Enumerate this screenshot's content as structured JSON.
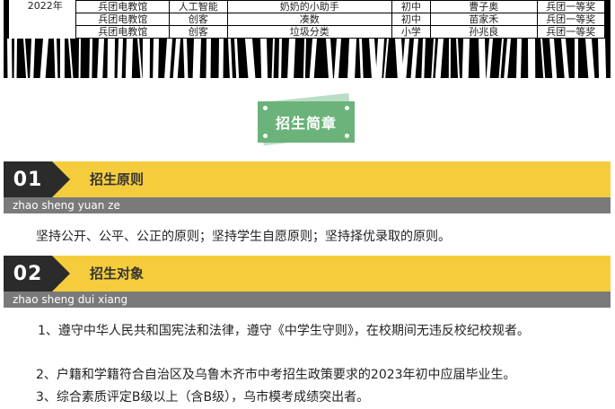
{
  "awards": {
    "year": "2022年",
    "rows": [
      [
        "兵团电教馆",
        "人工智能",
        "奶奶的小助手",
        "初中",
        "曹子奥",
        "兵团一等奖"
      ],
      [
        "兵团电教馆",
        "创客",
        "凑数",
        "初中",
        "苗家禾",
        "兵团一等奖"
      ],
      [
        "兵团电教馆",
        "创客",
        "垃圾分类",
        "小学",
        "孙兆良",
        "兵团一等奖"
      ]
    ]
  },
  "banner": {
    "label": "招生简章"
  },
  "section1": {
    "number": "01",
    "title": "招生原则",
    "pinyin": "zhao sheng yuan ze",
    "text": "坚持公开、公平、公正的原则；坚持学生自愿原则；坚持择优录取的原则。"
  },
  "section2": {
    "number": "02",
    "title": "招生对象",
    "pinyin": "zhao sheng dui xiang",
    "items": [
      "1、遵守中华人民共和国宪法和法律，遵守《中学生守则》，在校期间无违反校纪校规者。",
      "2、户籍和学籍符合自治区及乌鲁木齐市中考招生政策要求的2023年初中应届毕业生。",
      "3、综合素质评定B级以上（含B级），乌市模考成绩突出者。"
    ]
  },
  "colors": {
    "accent": "#f5cd3c",
    "dark": "#2b2b2b",
    "banner_green": "#6bb37a",
    "sub_gray": "#7a7a7a"
  }
}
